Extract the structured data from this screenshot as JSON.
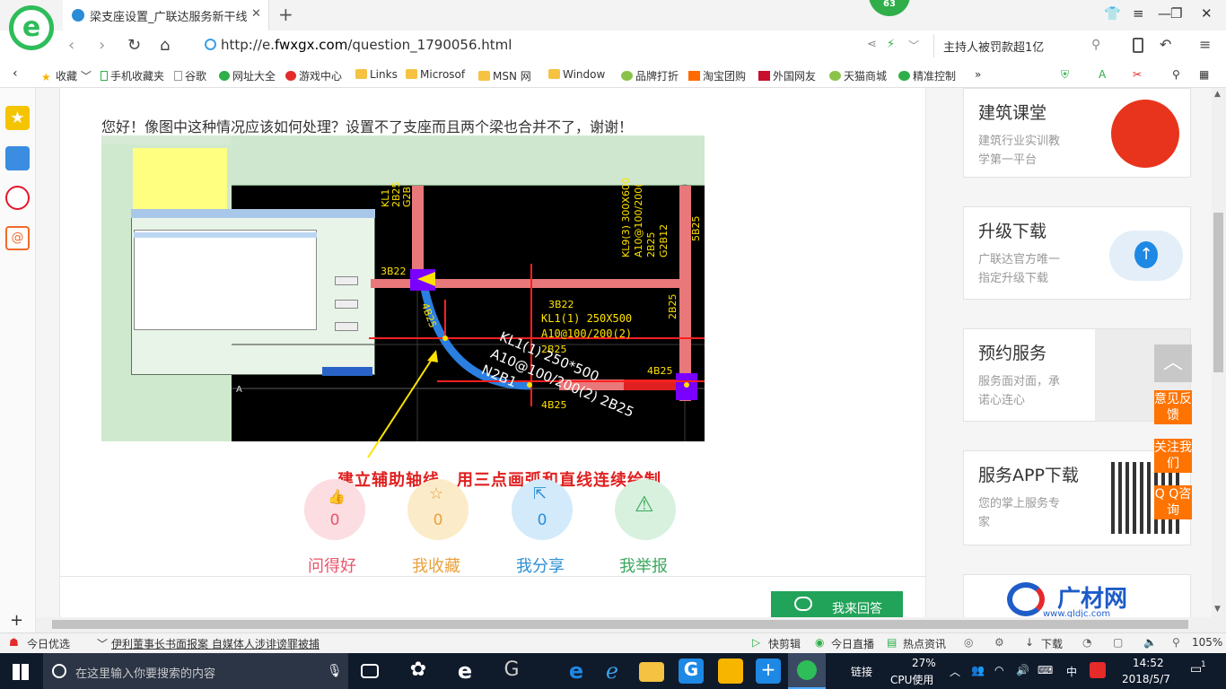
{
  "browser": {
    "tab_title": "梁支座设置_广联达服务新干线",
    "badge": "63",
    "url_prefix": "http://e.",
    "url_domain": "fwxgx.com",
    "url_path": "/question_1790056.html",
    "search_text": "主持人被罚款超1亿"
  },
  "bookmarks": [
    "收藏",
    "手机收藏夹",
    "谷歌",
    "网址大全",
    "游戏中心",
    "Links",
    "Microsof",
    "MSN 网",
    "Window",
    "品牌打折",
    "淘宝团购",
    "外国网友",
    "天猫商城",
    "精准控制"
  ],
  "question": {
    "text": "您好！像图中这种情况应该如何处理？设置不了支座而且两个梁也合并不了，谢谢！",
    "caption": "建立辅助轴线，用三点画弧和直线连续绘制"
  },
  "cad_labels": {
    "kl1_span": "KL1(1) 250X500",
    "kl1_stirrup": "A10@100/200(2)",
    "top_bar": "3B22",
    "top_bar_left": "3B22",
    "side_2b25": "2B25",
    "bar_4b25_a": "4B25",
    "bar_4b25_b": "4B25",
    "bar_4b25_c": "4B25",
    "kl9_1": "KL9(3) 300X600",
    "kl9_2": "A10@100/200(",
    "kl9_3": "2B25",
    "kl9_4": "G2B12",
    "arc_1": "KL1(1) 250*500",
    "arc_2": "A10@100/200(2) 2B25",
    "arc_3": "N2B1",
    "axis_a": "A",
    "left_kl": "KL1",
    "left_2b": "2B25",
    "left_g2": "G2B",
    "right_5b": "5B25"
  },
  "actions": [
    {
      "label": "问得好",
      "count": "0",
      "color": "#e8546b",
      "bg": "#fbdde2"
    },
    {
      "label": "我收藏",
      "count": "0",
      "color": "#e8a23c",
      "bg": "#fcebc9"
    },
    {
      "label": "我分享",
      "count": "0",
      "color": "#2c8fd6",
      "bg": "#d3eafb"
    },
    {
      "label": "我举报",
      "count": "0",
      "color": "#3aa85c",
      "bg": "#d8f1de"
    }
  ],
  "answer_button": "我来回答",
  "cards": [
    {
      "title": "建筑课堂",
      "desc1": "建筑行业实训教",
      "desc2": "学第一平台"
    },
    {
      "title": "升级下载",
      "desc1": "广联达官方唯一",
      "desc2": "指定升级下载"
    },
    {
      "title": "预约服务",
      "desc1": "服务面对面，承",
      "desc2": "诺心连心"
    },
    {
      "title": "服务APP下载",
      "desc1": "您的掌上服务专",
      "desc2": "家"
    }
  ],
  "brand_logo_text": "广材网",
  "brand_logo_url": "www.gldjc.com",
  "floats": {
    "feedback": "意见反馈",
    "follow": "关注我们",
    "qq": "Q Q咨询"
  },
  "statusbar": {
    "today": "今日优选",
    "news": "伊利董事长书面报案 自媒体人涉诽谤罪被捕",
    "kuaijian": "快剪辑",
    "live": "今日直播",
    "hot": "热点资讯",
    "download": "下载",
    "zoom": "105%"
  },
  "taskbar": {
    "search_placeholder": "在这里输入你要搜索的内容",
    "link": "链接",
    "cpu_pct": "27%",
    "cpu_label": "CPU使用",
    "ime": "中",
    "time": "14:52",
    "date": "2018/5/7",
    "notif": "1"
  }
}
